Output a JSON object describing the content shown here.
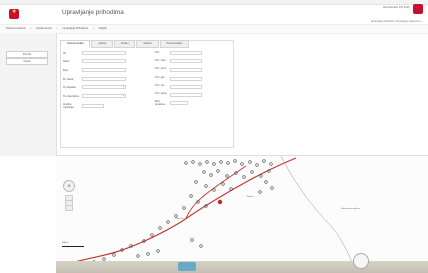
{
  "app": {
    "title": "Upravljanje prihodima"
  },
  "header": {
    "user_text": "Administrator KIS Kotor",
    "topnav_text": "Upravljanje prihodima | Upravljanje skupovima | ..."
  },
  "breadcrumb": {
    "parts": [
      "Početna stranica",
      "Opcija servisi",
      "Upravljanje Prihodima",
      "Objekti"
    ]
  },
  "sidebar": {
    "search_label": "Pretraži",
    "objects_label": "Objekti"
  },
  "tabs": [
    {
      "label": "Osnovni podaci"
    },
    {
      "label": "Adresa"
    },
    {
      "label": "Podaci"
    },
    {
      "label": "Vlasnici"
    },
    {
      "label": "Poreski podaci"
    }
  ],
  "form": {
    "left": [
      {
        "label": "ID:",
        "value": ""
      },
      {
        "label": "Naziv:",
        "value": ""
      },
      {
        "label": "Broj:",
        "value": ""
      },
      {
        "label": "Br. ulaza:",
        "value": ""
      },
      {
        "label": "Tip objekta:",
        "value": ""
      },
      {
        "label": "Tip vlasništva:",
        "value": ""
      },
      {
        "label": "Godina izgradnje:",
        "value": ""
      }
    ],
    "right": [
      {
        "label": "Pov.:",
        "value": ""
      },
      {
        "label": "Pov. stan.:",
        "value": ""
      },
      {
        "label": "Pov. posl.:",
        "value": ""
      },
      {
        "label": "Pov. gar.:",
        "value": ""
      },
      {
        "label": "Pov. ost.:",
        "value": ""
      },
      {
        "label": "Pov. ukup.:",
        "value": ""
      },
      {
        "label": "Broj spratova:",
        "value": ""
      }
    ]
  },
  "map": {
    "labels": [
      {
        "text": "Parcela"
      },
      {
        "text": "Katastarska opština"
      },
      {
        "text": "Objekat"
      }
    ],
    "scale_text": "200 m"
  },
  "colors": {
    "brand": "#c8102e",
    "road": "#c0392b"
  }
}
